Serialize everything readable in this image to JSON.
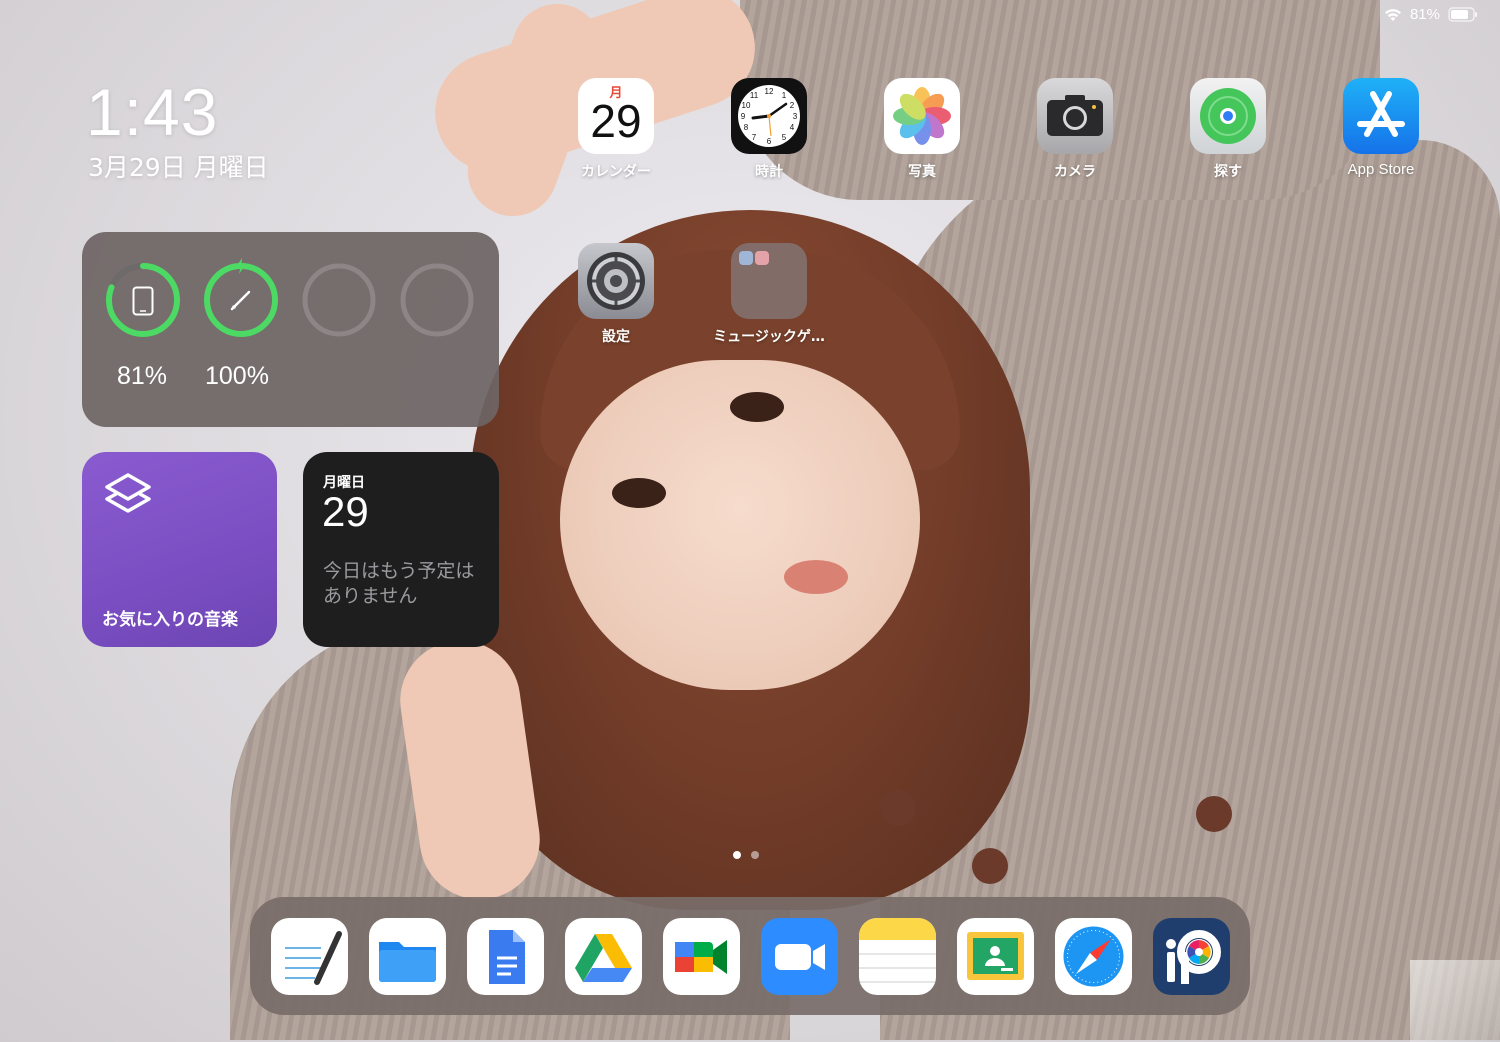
{
  "status_bar": {
    "battery_percent": "81%",
    "wifi_icon": "wifi-icon",
    "battery_icon": "battery-icon"
  },
  "lock_clock": {
    "time": "1:43",
    "date": "3月29日 月曜日"
  },
  "widgets": {
    "batteries": {
      "devices": [
        {
          "icon": "ipad-icon",
          "value": "81%",
          "level": 0.81,
          "charging": false
        },
        {
          "icon": "pencil-icon",
          "value": "100%",
          "level": 1.0,
          "charging": true
        },
        {
          "icon": "",
          "value": "",
          "level": 0
        },
        {
          "icon": "",
          "value": "",
          "level": 0
        }
      ]
    },
    "shortcuts": {
      "icon": "shortcuts-icon",
      "label": "お気に入りの音楽"
    },
    "calendar": {
      "weekday": "月曜日",
      "day": "29",
      "note": "今日はもう予定はありません"
    }
  },
  "apps": [
    {
      "name": "calendar",
      "label": "カレンダー",
      "month": "月",
      "day": "29"
    },
    {
      "name": "clock",
      "label": "時計"
    },
    {
      "name": "photos",
      "label": "写真"
    },
    {
      "name": "camera",
      "label": "カメラ"
    },
    {
      "name": "find-my",
      "label": "探す"
    },
    {
      "name": "app-store",
      "label": "App Store"
    },
    {
      "name": "settings",
      "label": "設定"
    },
    {
      "name": "music-games-folder",
      "label": "ミュージックゲ…"
    }
  ],
  "page_indicator": {
    "pages": 2,
    "current": 1
  },
  "dock": [
    {
      "name": "notes-writing",
      "icon": "handwriting-notes-icon"
    },
    {
      "name": "files",
      "icon": "files-icon"
    },
    {
      "name": "google-docs",
      "icon": "google-docs-icon"
    },
    {
      "name": "google-drive",
      "icon": "google-drive-icon"
    },
    {
      "name": "google-meet",
      "icon": "google-meet-icon"
    },
    {
      "name": "zoom",
      "icon": "zoom-icon"
    },
    {
      "name": "notes",
      "icon": "notes-icon"
    },
    {
      "name": "google-classroom",
      "icon": "google-classroom-icon"
    },
    {
      "name": "safari",
      "icon": "safari-icon"
    },
    {
      "name": "ibis-paint",
      "icon": "ibis-paint-icon"
    }
  ],
  "colors": {
    "ring_green": "#4cd964",
    "ring_empty": "#8e8686",
    "shortcut_purple": "#7a4ec2",
    "calendar_widget_bg": "#1e1e1f"
  }
}
